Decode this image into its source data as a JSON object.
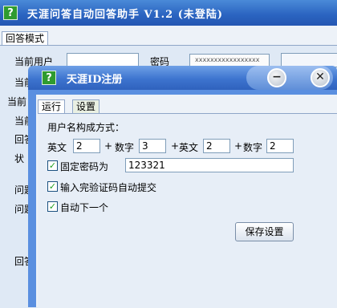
{
  "main_window": {
    "title": "天涯问答自动回答助手 V1.2 (未登陆)",
    "icon": "question-icon",
    "tab": "回答模式",
    "labels": {
      "current_user": "当前用户",
      "password": "密码",
      "row2": "当前",
      "row3": "当前",
      "row4": "当前",
      "row5": "回答",
      "row6": "状",
      "row7": "问题",
      "row8": "问题",
      "row9": "回答"
    },
    "password_value": "xxxxxxxxxxxxxxxxx"
  },
  "dialog": {
    "title": "天涯ID注册",
    "icon": "question-icon",
    "minimize_label": "−",
    "close_label": "✕",
    "tabs": [
      {
        "label": "运行",
        "active": false
      },
      {
        "label": "设置",
        "active": true
      }
    ],
    "section_label": "用户名构成方式：",
    "composition": {
      "en1_label": "英文",
      "en1_value": "2",
      "plus1": "+",
      "num1_label": "数字",
      "num1_value": "3",
      "plus2": "+",
      "en2_label": "英文",
      "en2_value": "2",
      "plus3": "+",
      "num2_label": "数字",
      "num2_value": "2"
    },
    "fixed_password": {
      "label": "固定密码为",
      "checked": true,
      "value": "123321"
    },
    "auto_submit": {
      "label": "输入完验证码自动提交",
      "checked": true
    },
    "auto_next": {
      "label": "自动下一个",
      "checked": true
    },
    "save_button": "保存设置"
  }
}
